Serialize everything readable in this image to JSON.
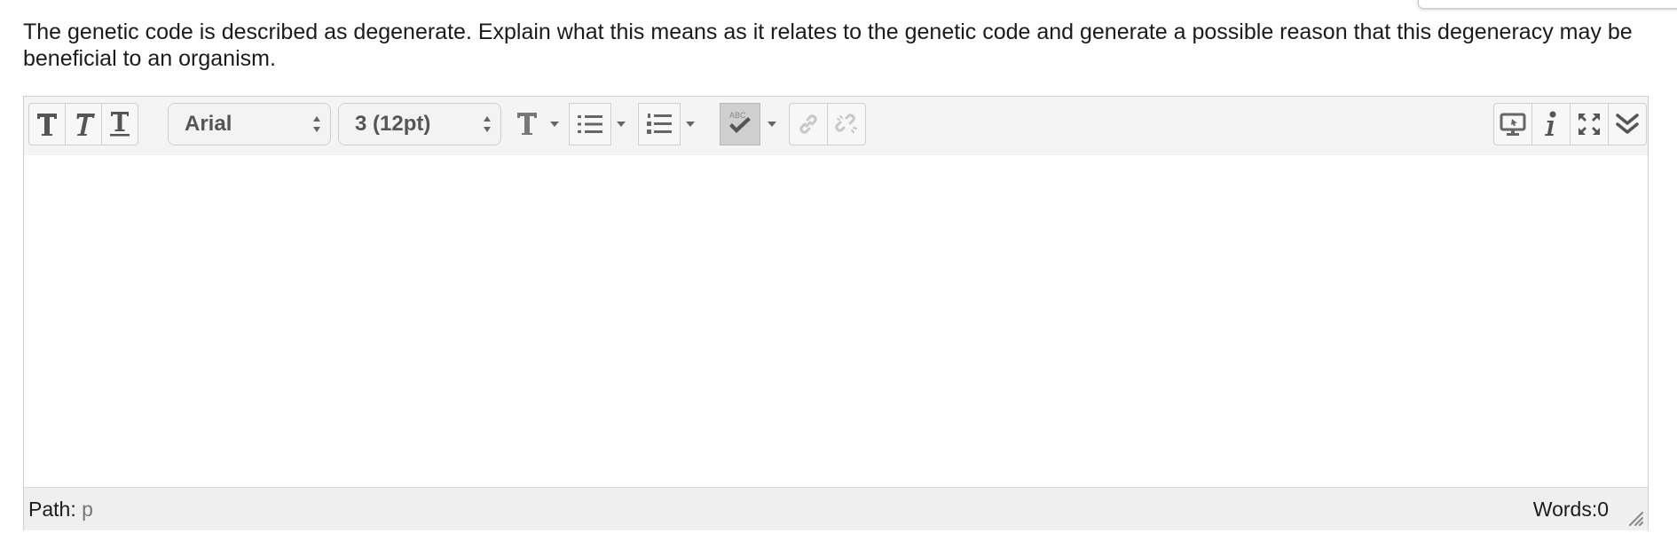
{
  "question": {
    "text": "The genetic code is described as degenerate.  Explain what this means as it relates to the genetic code and generate a possible reason that this degeneracy may be beneficial to an organism."
  },
  "toolbar": {
    "bold_icon": "bold-T-icon",
    "italic_icon": "italic-T-icon",
    "underline_icon": "underline-T-icon",
    "font_family": "Arial",
    "font_size": "3 (12pt)",
    "text_color_icon": "text-color-T-icon",
    "bullet_list_icon": "bullet-list-icon",
    "numbered_list_icon": "numbered-list-icon",
    "spellcheck_icon": "abc-check-icon",
    "link_icon": "link-icon",
    "unlink_icon": "unlink-icon",
    "preview_icon": "monitor-icon",
    "info_icon": "info-icon",
    "fullscreen_icon": "expand-icon",
    "collapse_icon": "double-chevron-down-icon"
  },
  "editor": {
    "content": ""
  },
  "status": {
    "path_label": "Path:",
    "path_value": "p",
    "words_label": "Words:0"
  },
  "colors": {
    "toolbar_bg": "#f4f4f4",
    "status_bg": "#efefef",
    "icon": "#666666",
    "spellcheck_active": "#cfcfcf"
  }
}
